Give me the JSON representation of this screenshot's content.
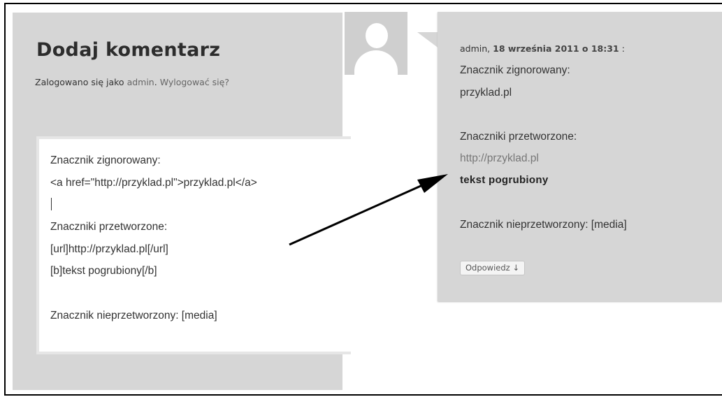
{
  "form": {
    "title": "Dodaj komentarz",
    "logged_prefix": "Zalogowano się jako",
    "user_link": "admin",
    "logout_link": "Wylogować się?",
    "textarea_lines": [
      "Znacznik zignorowany:",
      "<a href=\"http://przyklad.pl\">przyklad.pl</a>",
      "",
      "Znaczniki przetworzone:",
      "[url]http://przyklad.pl[/url]",
      "[b]tekst pogrubiony[/b]",
      "",
      "Znacznik nieprzetworzony: [media]"
    ]
  },
  "avatar": {
    "icon": "default-user-avatar-icon"
  },
  "comment": {
    "author": "admin,",
    "date": "18 września 2011 o 18:31",
    "date_suffix": ":",
    "ignored_label": "Znacznik zignorowany:",
    "ignored_value": "przyklad.pl",
    "processed_label": "Znaczniki przetworzone:",
    "processed_link": "http://przyklad.pl",
    "processed_bold": "tekst pogrubiony",
    "unprocessed_line": "Znacznik nieprzetworzony: [media]",
    "reply_label": "Odpowiedz ↓"
  },
  "colors": {
    "panel_bg": "#d6d6d6",
    "link": "#666666",
    "text": "#333333"
  }
}
